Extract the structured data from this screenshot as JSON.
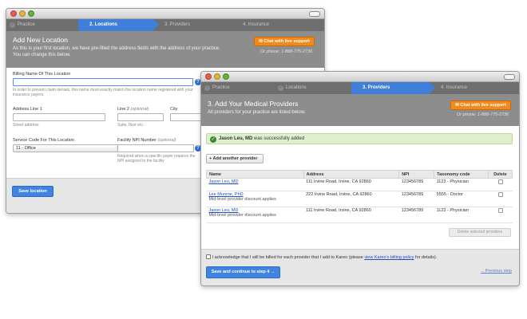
{
  "back_window": {
    "steps": [
      {
        "label": "Practice",
        "state": "done"
      },
      {
        "label": "2. Locations",
        "state": "active"
      },
      {
        "label": "3. Providers",
        "state": "todo"
      },
      {
        "label": "4. Insurance",
        "state": "todo"
      }
    ],
    "title": "Add New Location",
    "description": "As this is your first location, we have pre-filled the address fields with the address of your practice. You can change this below.",
    "chat_button": "Chat with live support",
    "phone": "Or phone: 1-888-775-2736",
    "billing_name_label": "Billing Name Of This Location",
    "billing_name_hint": "In order to prevent claim denials, this name must exactly match the location name registered with your insurance payers.",
    "address1_label": "Address Line 1",
    "address1_hint": "Street address",
    "line2_label": "Line 2",
    "line2_optional": "(optional)",
    "line2_hint": "Suite, floor etc.",
    "city_label": "City",
    "service_code_label": "Service Code For This Location",
    "service_code_value": "11 - Office",
    "npi_label": "Facility NPI Number",
    "npi_optional": "(optional)",
    "npi_hint": "Required when a specific payer requires the NPI assigned to the facility",
    "save_button": "Save location"
  },
  "front_window": {
    "steps": [
      {
        "label": "Practice",
        "state": "done"
      },
      {
        "label": "Locations",
        "state": "done"
      },
      {
        "label": "3. Providers",
        "state": "active"
      },
      {
        "label": "4. Insurance",
        "state": "todo"
      }
    ],
    "title": "3. Add Your Medical Providers",
    "description": "All providers for your practice are listed below.",
    "chat_button": "Chat with live support",
    "phone": "Or phone: 1-888-775-2736",
    "success_name": "Jason Leu, MD",
    "success_text": " was successfully added",
    "add_provider_button": "Add another provider",
    "table": {
      "headers": [
        "Name",
        "Address",
        "NPI",
        "Taxonomy code",
        "Delete"
      ],
      "rows": [
        {
          "name": "Jason Leu, MD",
          "sub": "",
          "address": "111 Irvine Road, Irvine, CA 92860",
          "npi": "123456789",
          "taxonomy": "1123 - Physician"
        },
        {
          "name": "Lee Munroe, PhD",
          "sub": "Mid-level provider discount applies",
          "address": "222 Irvine Road, Irvine, CA 92860",
          "npi": "123456789",
          "taxonomy": "5555 - Doctor"
        },
        {
          "name": "Jason Leu, MD",
          "sub": "Mid-level provider discount applies",
          "address": "111 Irvine Road, Irvine, CA 92860",
          "npi": "123456789",
          "taxonomy": "1123 - Physician"
        }
      ]
    },
    "delete_selected_button": "Delete selected providers",
    "ack_pre": "I acknowledge that I will be billed for each provider that I add to Kareo (please ",
    "ack_link": "view Kareo's billing policy",
    "ack_post": " for details).",
    "continue_button": "Save and continue to step 4 →",
    "previous_link": "←Previous step"
  },
  "colors": {
    "accent_blue": "#3f84e0",
    "orange": "#f08a1c",
    "success_green": "#dff0cf"
  }
}
